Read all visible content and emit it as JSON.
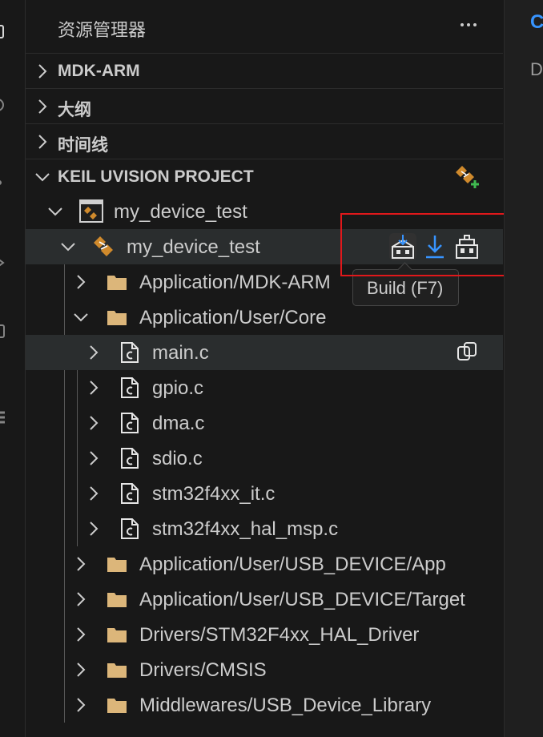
{
  "explorer": {
    "title": "资源管理器",
    "more_icon": "ellipsis-icon"
  },
  "sections": {
    "mdk_arm": "MDK-ARM",
    "outline": "大纲",
    "timeline": "时间线",
    "keil": "KEIL UVISION PROJECT"
  },
  "project": {
    "workspace_name": "my_device_test",
    "target_name": "my_device_test",
    "actions": [
      {
        "name": "build",
        "icon": "build-icon"
      },
      {
        "name": "download",
        "icon": "download-icon"
      },
      {
        "name": "rebuild",
        "icon": "rebuild-icon"
      }
    ],
    "tooltip": "Build (F7)",
    "groups": [
      {
        "label": "Application/MDK-ARM",
        "expanded": false
      },
      {
        "label": "Application/User/Core",
        "expanded": true
      },
      {
        "label": "Application/User/USB_DEVICE/App",
        "expanded": false
      },
      {
        "label": "Application/User/USB_DEVICE/Target",
        "expanded": false
      },
      {
        "label": "Drivers/STM32F4xx_HAL_Driver",
        "expanded": false
      },
      {
        "label": "Drivers/CMSIS",
        "expanded": false
      },
      {
        "label": "Middlewares/USB_Device_Library",
        "expanded": false
      }
    ],
    "core_files": [
      "main.c",
      "gpio.c",
      "dma.c",
      "sdio.c",
      "stm32f4xx_it.c",
      "stm32f4xx_hal_msp.c"
    ]
  },
  "editor": {
    "tab_fragment": "C",
    "line_fragment": "D"
  },
  "colors": {
    "background": "#181818",
    "hover_row": "#2a2d2e",
    "text": "#cccccc",
    "highlight_border": "#e0181b",
    "keil_orange": "#d08a2c",
    "folder": "#dcb67a"
  }
}
